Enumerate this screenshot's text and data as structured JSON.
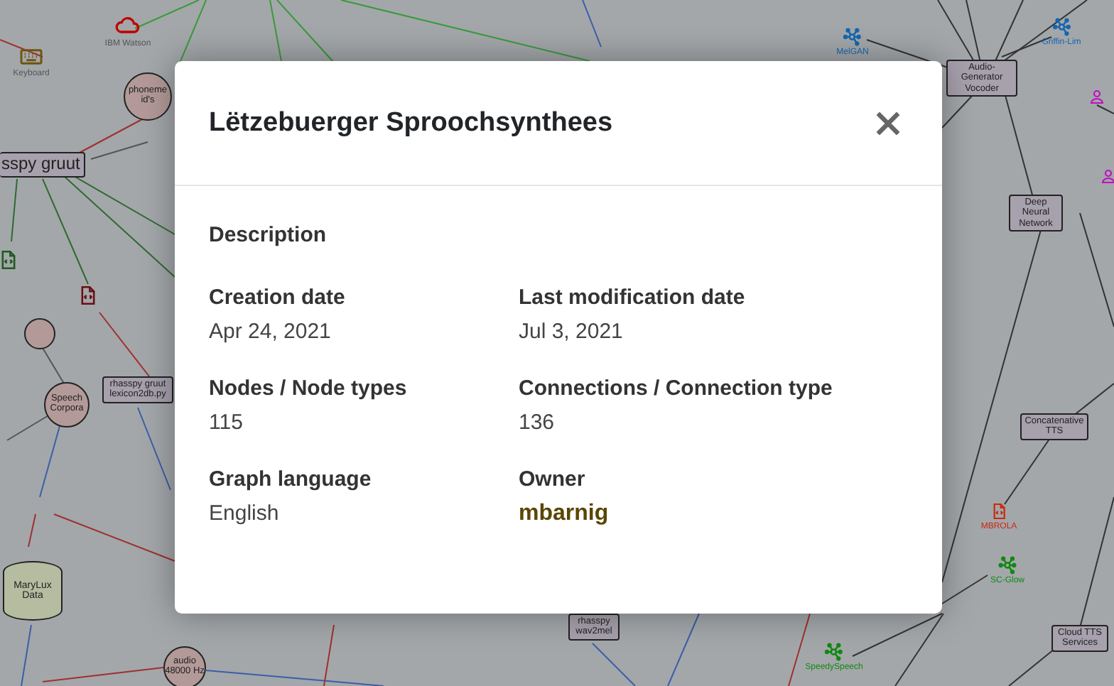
{
  "graph": {
    "nodes": [
      {
        "label": "IBM Watson",
        "kind": "cloud",
        "color": "#c00000"
      },
      {
        "label": "Griffin-Lim",
        "kind": "network",
        "color": "#1566b0"
      },
      {
        "label": "MelGAN",
        "kind": "network",
        "color": "#1566b0"
      },
      {
        "label": "Keyboard",
        "kind": "keyboard",
        "color": "#6e5410"
      },
      {
        "label": "Audio-Generator Vocoder",
        "kind": "box"
      },
      {
        "label": "phoneme id's",
        "kind": "circle"
      },
      {
        "kind": "person",
        "color": "#c010c0"
      },
      {
        "label": "sspy gruut",
        "kind": "box"
      },
      {
        "kind": "person",
        "color": "#c010c0"
      },
      {
        "label": "Deep Neural Network",
        "kind": "box"
      },
      {
        "kind": "file",
        "color": "#1f5a1f"
      },
      {
        "kind": "file",
        "color": "#6a0f14"
      },
      {
        "kind": "circle"
      },
      {
        "label": "rhasspy gruut lexicon2db.py",
        "kind": "box"
      },
      {
        "label": "Speech Corpora",
        "kind": "circle"
      },
      {
        "label": "Concatenative TTS",
        "kind": "box"
      },
      {
        "label": "MBROLA",
        "kind": "file",
        "color": "#c8290c"
      },
      {
        "label": "MaryLux Data",
        "kind": "cylinder"
      },
      {
        "label": "SC-Glow",
        "kind": "network",
        "color": "#118811"
      },
      {
        "label": "rhasspy wav2mel",
        "kind": "box"
      },
      {
        "label": "Cloud TTS Services",
        "kind": "box"
      },
      {
        "label": "audio 48000 Hz",
        "kind": "circle"
      },
      {
        "label": "SpeedySpeech",
        "kind": "network",
        "color": "#118811"
      }
    ]
  },
  "dialog": {
    "title": "Lëtzebuerger Sproochsynthees",
    "section": "Description",
    "fields": [
      {
        "label": "Creation date",
        "value": "Apr 24, 2021",
        "kind": "text"
      },
      {
        "label": "Last modification date",
        "value": "Jul 3, 2021",
        "kind": "text"
      },
      {
        "label": "Nodes / Node types",
        "value": "115",
        "kind": "text"
      },
      {
        "label": "Connections / Connection type",
        "value": "136",
        "kind": "text"
      },
      {
        "label": "Graph language",
        "value": "English",
        "kind": "text"
      },
      {
        "label": "Owner",
        "value": "mbarnig",
        "kind": "link"
      }
    ]
  }
}
